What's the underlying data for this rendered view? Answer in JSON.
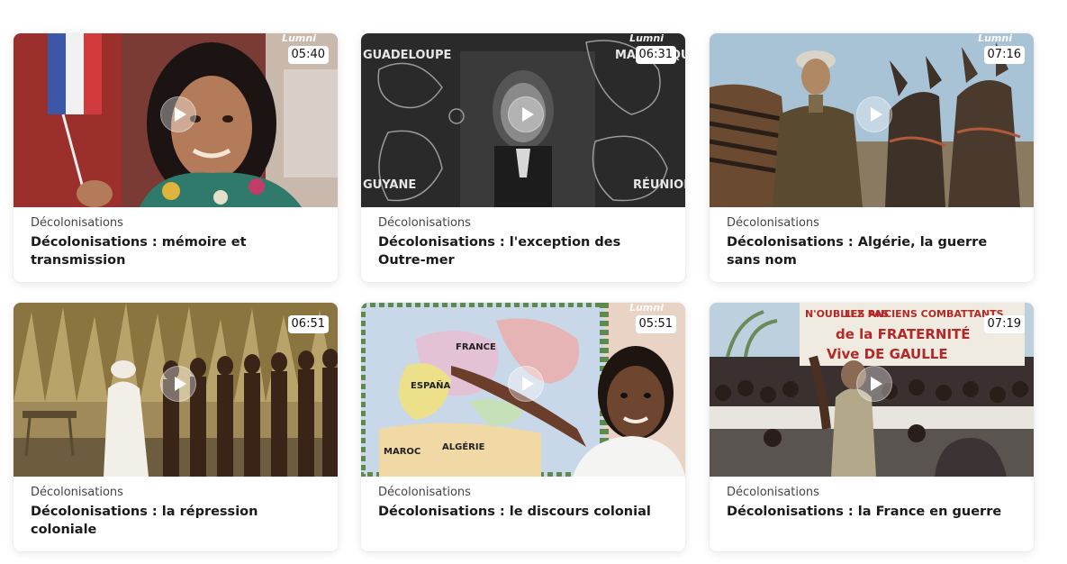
{
  "brand_watermark": "Lumni",
  "videos": [
    {
      "category": "Décolonisations",
      "title": "Décolonisations : mémoire et transmission",
      "duration": "05:40",
      "thumbnail_icon": "girl-with-flag-image"
    },
    {
      "category": "Décolonisations",
      "title": "Décolonisations : l'exception des Outre-mer",
      "duration": "06:31",
      "thumbnail_icon": "overseas-territories-map-image",
      "map_labels": [
        "GUADELOUPE",
        "MARTINIQUE",
        "GUYANE",
        "RÉUNION"
      ]
    },
    {
      "category": "Décolonisations",
      "title": "Décolonisations : Algérie, la guerre sans nom",
      "duration": "07:16",
      "thumbnail_icon": "soldier-with-mules-image"
    },
    {
      "category": "Décolonisations",
      "title": "Décolonisations : la répression coloniale",
      "duration": "06:51",
      "thumbnail_icon": "colonial-village-image"
    },
    {
      "category": "Décolonisations",
      "title": "Décolonisations : le discours colonial",
      "duration": "05:51",
      "thumbnail_icon": "boy-pointing-map-image",
      "map_labels": [
        "FRANCE",
        "ESPAÑA",
        "MAROC",
        "ALGÉRIE"
      ]
    },
    {
      "category": "Décolonisations",
      "title": "Décolonisations : la France en guerre",
      "duration": "07:19",
      "thumbnail_icon": "crowd-with-banner-image",
      "banner_lines": [
        "N'OUBLIEZ PAS",
        "LES ANCIENS COMBATTANTS",
        "de la FRATERNITÉ",
        "Vive DE GAULLE"
      ]
    }
  ]
}
